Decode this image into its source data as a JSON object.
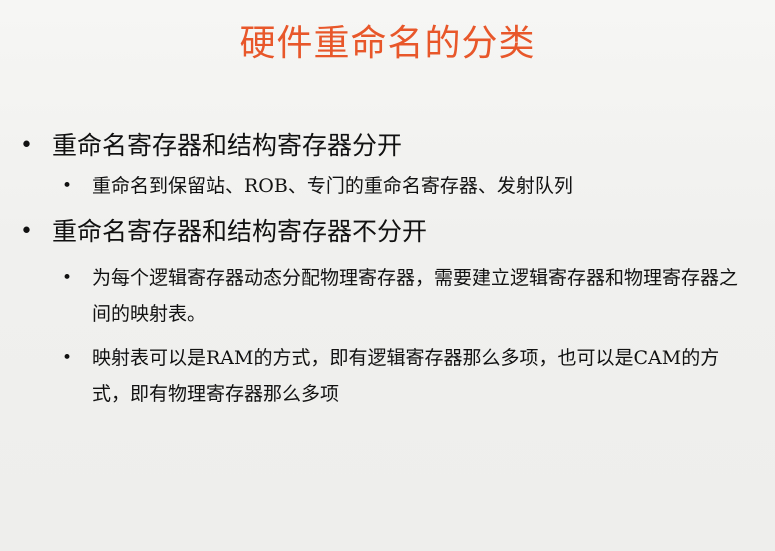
{
  "slide": {
    "title": "硬件重命名的分类",
    "bullets": [
      {
        "text": "重命名寄存器和结构寄存器分开",
        "sub": [
          "重命名到保留站、ROB、专门的重命名寄存器、发射队列"
        ]
      },
      {
        "text": "重命名寄存器和结构寄存器不分开",
        "sub": [
          "为每个逻辑寄存器动态分配物理寄存器，需要建立逻辑寄存器和物理寄存器之间的映射表。",
          "映射表可以是RAM的方式，即有逻辑寄存器那么多项，也可以是CAM的方式，即有物理寄存器那么多项"
        ]
      }
    ],
    "bullet_glyph": "•",
    "colors": {
      "title": "#e8572a",
      "text": "#111111",
      "background": "#f0f0ee"
    }
  }
}
